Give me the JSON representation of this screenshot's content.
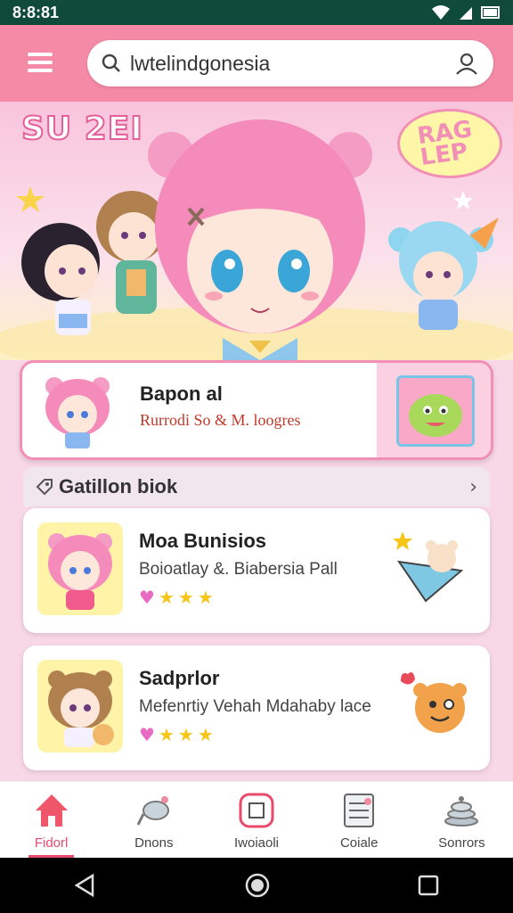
{
  "status_bar": {
    "time": "8:8:81"
  },
  "header": {
    "search_text": "lwtelindgonesia"
  },
  "hero": {
    "logo_text": "SU 2EI",
    "bubble_text": "RAG LEP"
  },
  "featured": {
    "title": "Bapon al",
    "subtitle": "Rurrodi So & M. loogres"
  },
  "section": {
    "title": "Gatillon biok",
    "chevron": "›"
  },
  "cards": [
    {
      "title": "Moa Bunisios",
      "subtitle": "Boioatlay &. Biabersia Pall",
      "rating_icons": [
        "heart-icon",
        "star-icon",
        "star-icon",
        "star-icon"
      ]
    },
    {
      "title": "Sadprlor",
      "subtitle": "Mefenrtiy Vehah Mdahaby lace",
      "rating_icons": [
        "heart-icon",
        "star-icon",
        "star-icon",
        "star-icon"
      ]
    }
  ],
  "bottom_nav": [
    {
      "label": "Fidorl",
      "icon": "home-icon",
      "active": true
    },
    {
      "label": "Dnons",
      "icon": "bird-icon",
      "active": false
    },
    {
      "label": "Iwoiaoli",
      "icon": "book-icon",
      "active": false
    },
    {
      "label": "Coiale",
      "icon": "document-icon",
      "active": false
    },
    {
      "label": "Sonrors",
      "icon": "stack-icon",
      "active": false
    }
  ],
  "colors": {
    "header": "#f48aa6",
    "accent": "#e84a6c",
    "statusbar": "#0f4a3a"
  }
}
